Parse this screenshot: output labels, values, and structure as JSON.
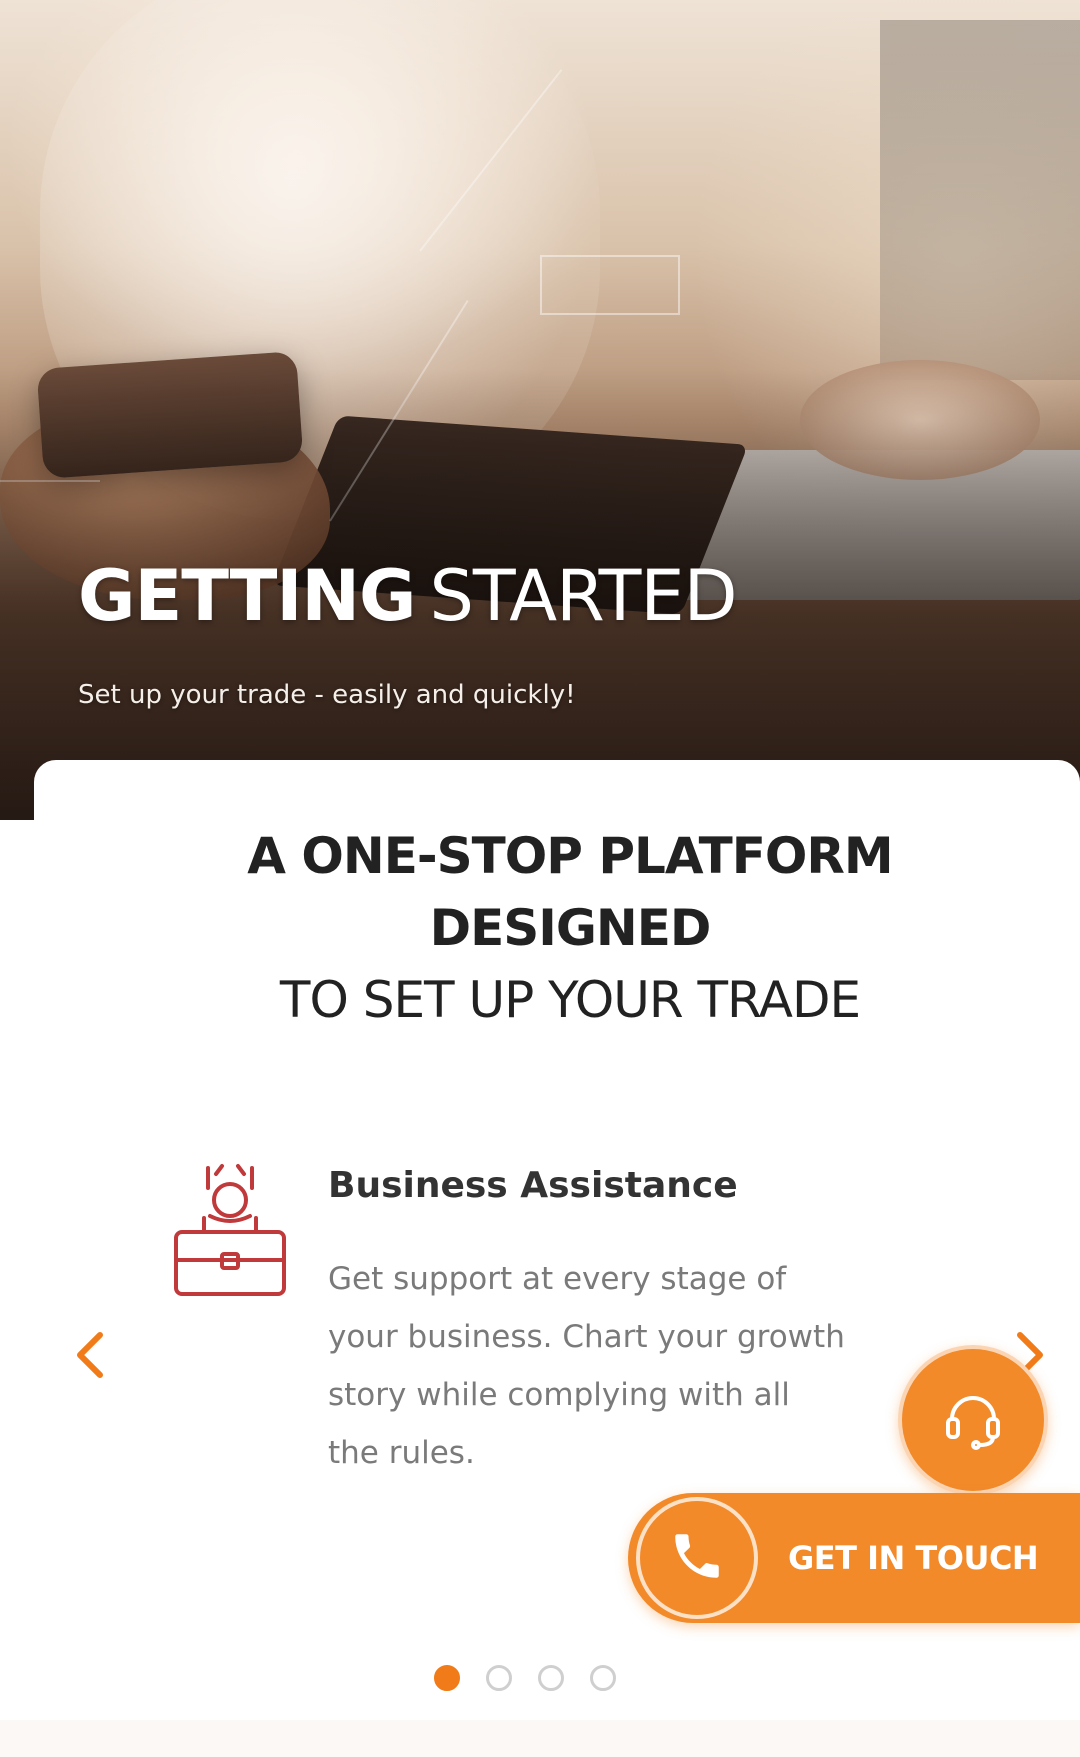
{
  "hero": {
    "title_bold": "GETTING",
    "title_light": "STARTED",
    "subtitle": "Set up your trade - easily and quickly!"
  },
  "headline": {
    "line1": "A ONE-STOP PLATFORM",
    "line2": "DESIGNED",
    "line3": "TO SET UP YOUR TRADE"
  },
  "feature": {
    "icon": "briefcase-icon",
    "title": "Business Assistance",
    "description": "Get support at every stage of your business. Chart your growth story while complying with all the rules."
  },
  "carousel": {
    "prev_icon": "chevron-left-icon",
    "next_icon": "chevron-right-icon",
    "pages": 4,
    "active_index": 0
  },
  "buttons": {
    "support_icon": "headset-icon",
    "get_in_touch_label": "GET IN TOUCH",
    "get_in_touch_icon": "phone-icon"
  },
  "colors": {
    "accent": "#f28a2a",
    "icon_red": "#c0393b",
    "dot_active": "#f07b18"
  }
}
